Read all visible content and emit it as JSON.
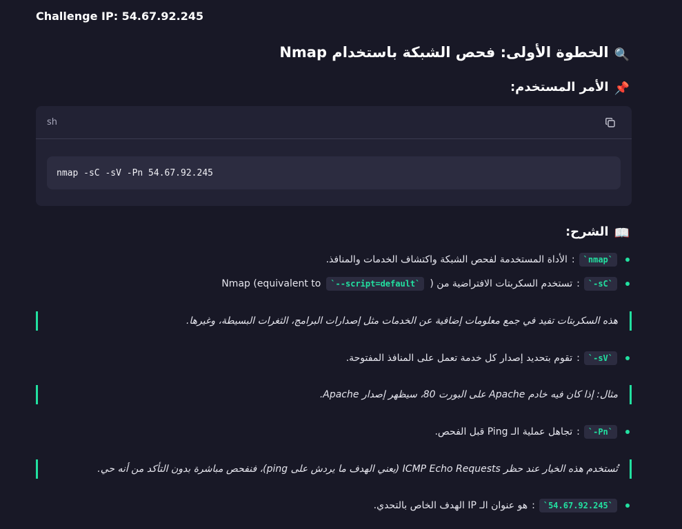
{
  "challenge": {
    "label": "Challenge IP: 54.67.92.245"
  },
  "step1": {
    "heading_icon": "🔍",
    "heading": "الخطوة الأولى: فحص الشبكة باستخدام Nmap",
    "command_icon": "📌",
    "command_heading": "الأمر المستخدم:",
    "code_block": {
      "language": "sh",
      "copy_icon": "copy-icon",
      "command": "nmap -sC -sV -Pn 54.67.92.245"
    },
    "explanation_icon": "📖",
    "explanation_heading": "الشرح:",
    "items": [
      {
        "code": "`nmap`",
        "text": "الأداة المستخدمة لفحص الشبكة واكتشاف الخدمات والمنافذ."
      },
      {
        "code": "`-sC`",
        "text": "تستخدم السكربتات الافتراضية من (",
        "code2": "`--script=default`",
        "text2": "Nmap (equivalent to"
      },
      {
        "code": "`-sV`",
        "text": "تقوم بتحديد إصدار كل خدمة تعمل على المنافذ المفتوحة."
      },
      {
        "code": "`-Pn`",
        "text": "تجاهل عملية الـ Ping قبل الفحص."
      },
      {
        "code": "`54.67.92.245`",
        "text": "هو عنوان الـ IP الهدف الخاص بالتحدي."
      }
    ],
    "quotes": [
      "هذه السكربتات تفيد في جمع معلومات إضافية عن الخدمات مثل إصدارات البرامج، الثغرات البسيطة، وغيرها.",
      "مثال: إذا كان فيه خادم Apache على البورت 80، سيظهر إصدار Apache.",
      "تُستخدم هذه الخيار عند حظر ICMP Echo Requests (يعني الهدف ما يردش على ping)، فنفحص مباشرة بدون التأكد من أنه حي."
    ]
  },
  "colors": {
    "accent": "#22e0a0",
    "background": "#181826",
    "card": "#222234"
  }
}
